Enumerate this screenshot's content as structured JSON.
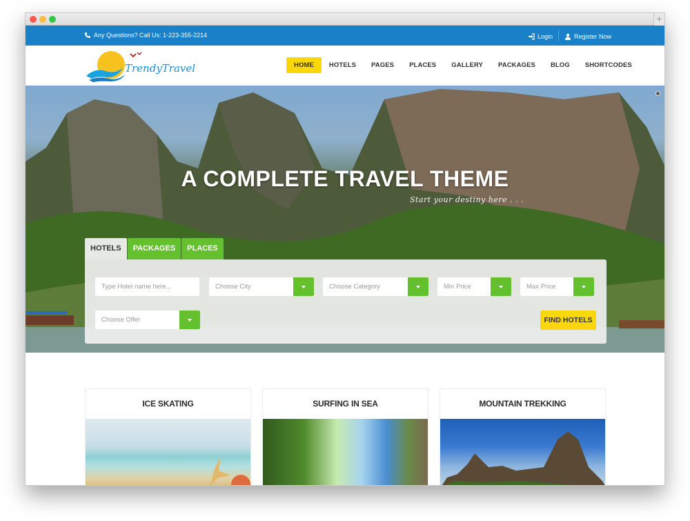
{
  "window": {
    "controls": [
      "close",
      "minimize",
      "zoom"
    ],
    "new_tab_label": "+"
  },
  "topbar": {
    "contact_icon": "phone-icon",
    "contact_text": "Any Questions? Call Us: 1-223-355-2214",
    "login_icon": "sign-in-icon",
    "login_label": "Login",
    "register_icon": "user-icon",
    "register_label": "Register Now",
    "bg_color": "#1a80c8"
  },
  "header": {
    "logo_text": "TrendyTravel",
    "nav": [
      {
        "label": "HOME",
        "active": true
      },
      {
        "label": "HOTELS",
        "active": false
      },
      {
        "label": "PAGES",
        "active": false
      },
      {
        "label": "PLACES",
        "active": false
      },
      {
        "label": "GALLERY",
        "active": false
      },
      {
        "label": "PACKAGES",
        "active": false
      },
      {
        "label": "BLOG",
        "active": false
      },
      {
        "label": "SHORTCODES",
        "active": false
      }
    ],
    "accent_color": "#f9d70b"
  },
  "hero": {
    "title": "A COMPLETE TRAVEL THEME",
    "subtitle": "Start your destiny here . . ."
  },
  "search": {
    "tabs": [
      {
        "label": "HOTELS",
        "active": true
      },
      {
        "label": "PACKAGES",
        "active": false
      },
      {
        "label": "PLACES",
        "active": false
      }
    ],
    "hotel_name_placeholder": "Type Hotel name here...",
    "city_select": "Choose City",
    "category_select": "Choose Category",
    "min_price_select": "Min Price",
    "max_price_select": "Max Price",
    "offer_select": "Choose Offer",
    "submit_label": "FIND HOTELS",
    "green_color": "#64c02c"
  },
  "cards": [
    {
      "title": "ICE SKATING",
      "image": "beach-starfish"
    },
    {
      "title": "SURFING IN SEA",
      "image": "sea-cliffs-sunlight"
    },
    {
      "title": "MOUNTAIN TREKKING",
      "image": "limestone-peaks-blue-sky"
    }
  ]
}
